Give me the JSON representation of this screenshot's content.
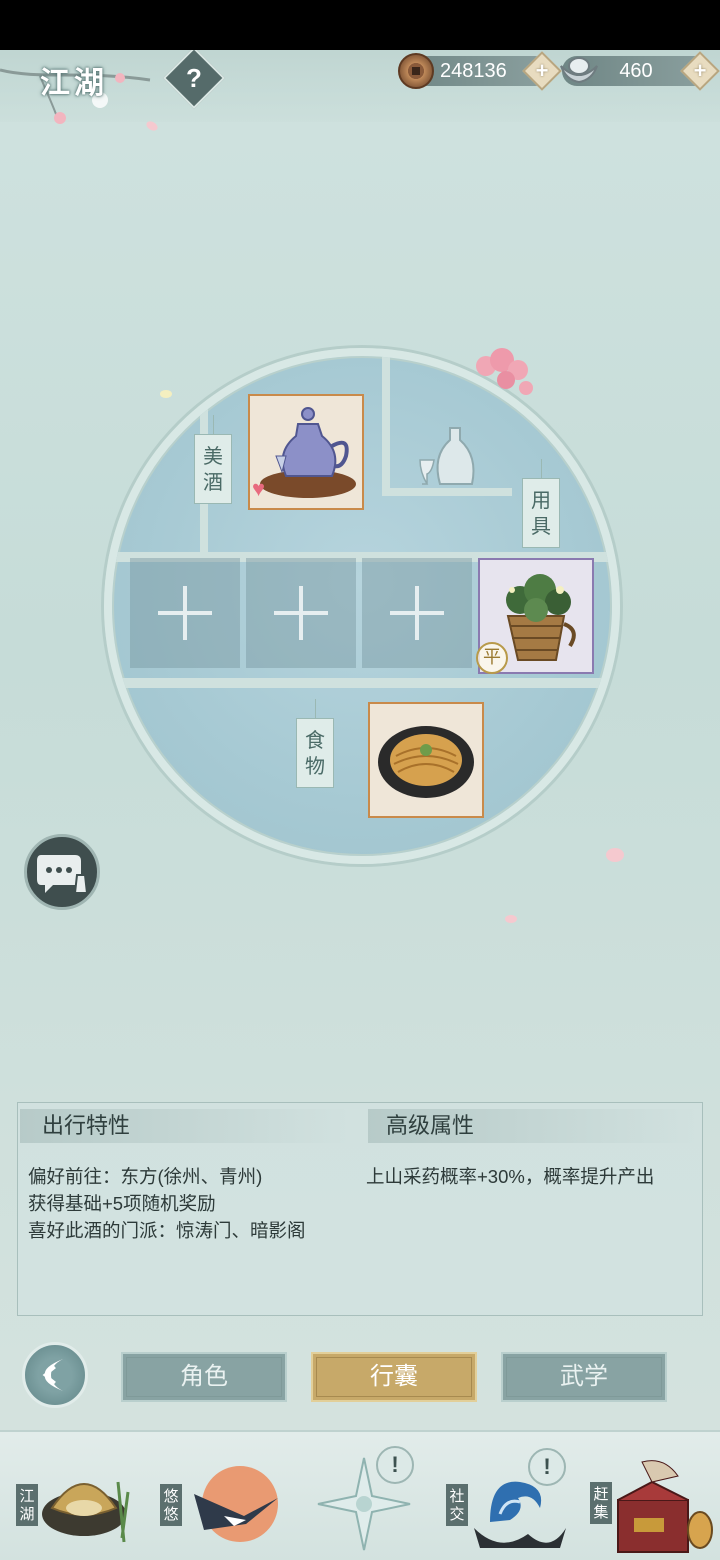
{
  "header": {
    "title": "江湖",
    "help_label": "?",
    "coins": "248136",
    "silver": "460",
    "add_label": "+"
  },
  "shelf": {
    "tags": {
      "wine": "美酒",
      "tools": "用具",
      "food": "食物"
    },
    "empty_slot_label": "+",
    "items": {
      "wine_badge": "♥",
      "tool_badge": "平"
    }
  },
  "panel": {
    "left_title": "出行特性",
    "right_title": "高级属性",
    "left_lines": [
      "偏好前往：东方(徐州、青州)",
      "获得基础+5项随机奖励",
      "喜好此酒的门派：惊涛门、暗影阁"
    ],
    "right_lines": [
      "上山采药概率+30%，概率提升产出"
    ]
  },
  "tabs": [
    "角色",
    "行囊",
    "武学"
  ],
  "active_tab": "行囊",
  "bottom_nav": [
    {
      "label": "江湖",
      "has_alert": false
    },
    {
      "label": "悠悠",
      "has_alert": false
    },
    {
      "label": "",
      "has_alert": true
    },
    {
      "label": "社交",
      "has_alert": true
    },
    {
      "label": "赶集",
      "has_alert": false
    }
  ],
  "alert_symbol": "!",
  "colors": {
    "active_tab": "#c7a969",
    "inactive_tab": "#88a3a3",
    "window_bg": "#a6c9d3"
  }
}
